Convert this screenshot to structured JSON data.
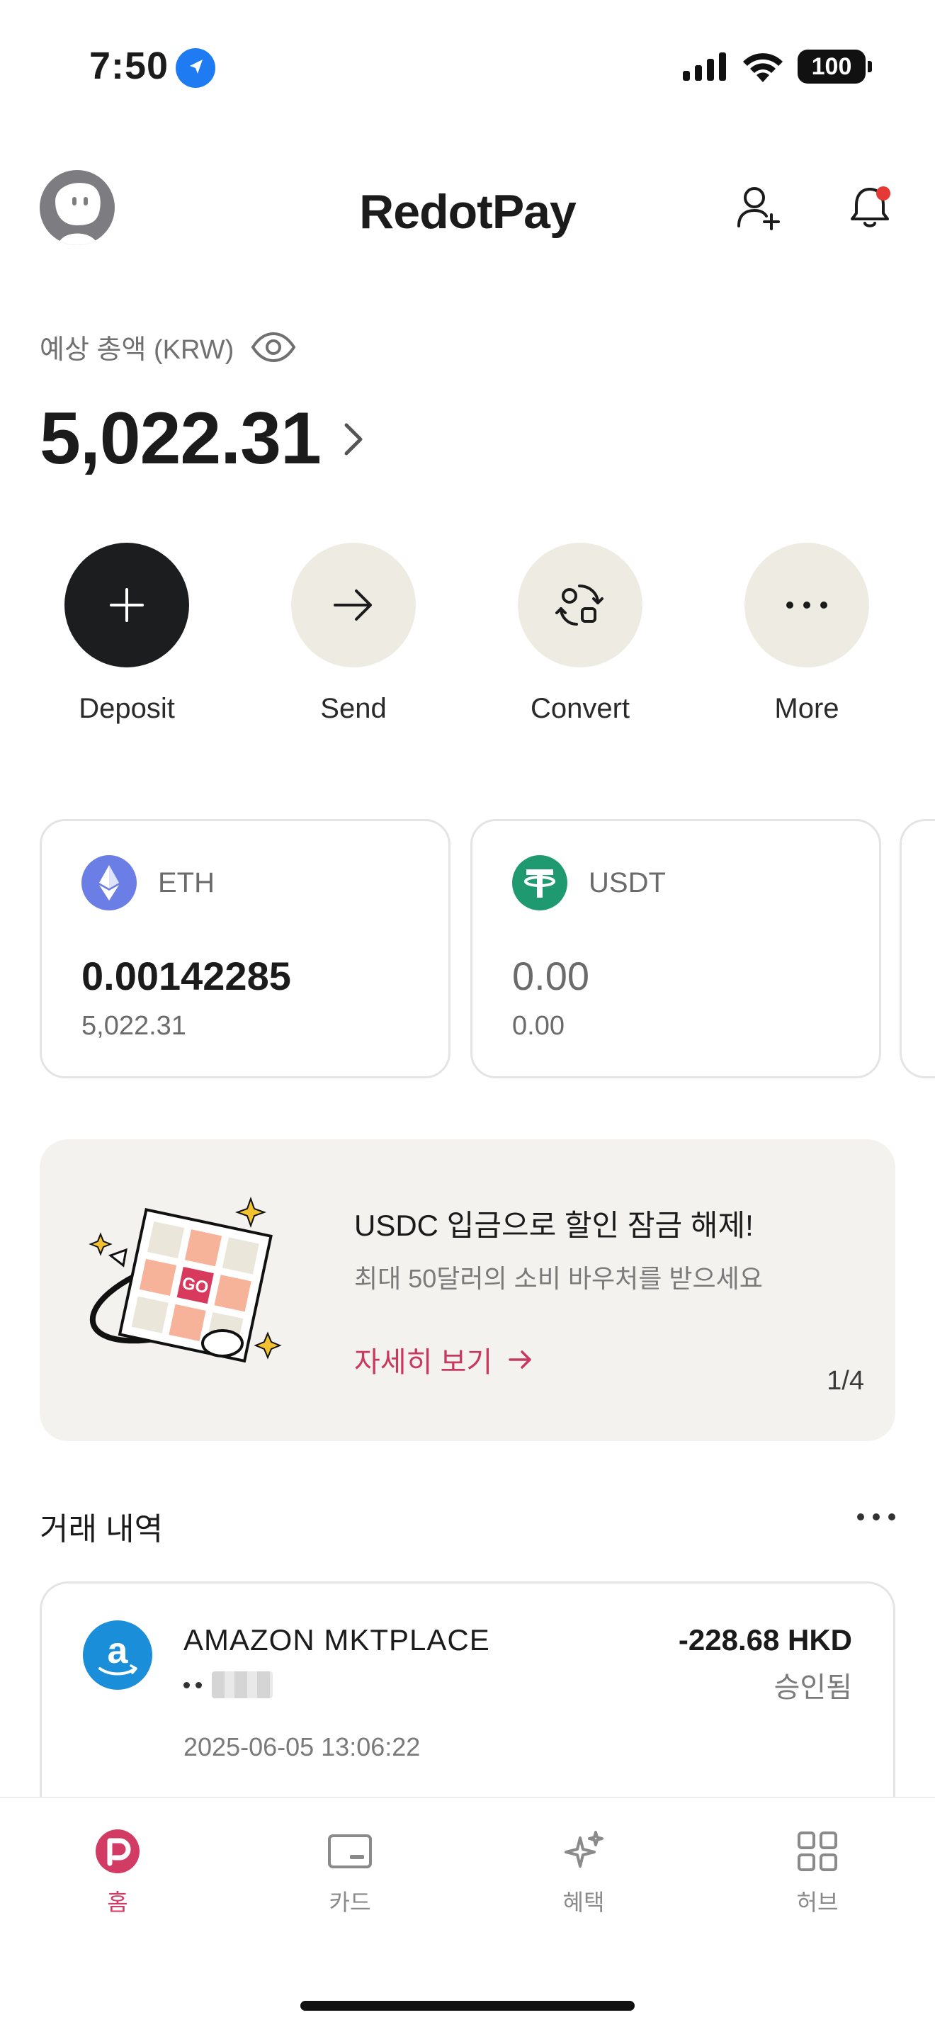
{
  "status_bar": {
    "time": "7:50",
    "battery": "100"
  },
  "header": {
    "brand": "RedotPay",
    "icons": [
      "avatar",
      "add-user-icon",
      "bell-icon"
    ]
  },
  "balance": {
    "label": "예상 총액 (KRW)",
    "value": "5,022.31"
  },
  "actions": [
    {
      "label": "Deposit",
      "icon": "plus-icon"
    },
    {
      "label": "Send",
      "icon": "arrow-right-icon"
    },
    {
      "label": "Convert",
      "icon": "convert-icon"
    },
    {
      "label": "More",
      "icon": "more-icon"
    }
  ],
  "assets": [
    {
      "symbol": "ETH",
      "amount": "0.00142285",
      "fiat": "5,022.31",
      "color": "#6a7ee6"
    },
    {
      "symbol": "USDT",
      "amount": "0.00",
      "fiat": "0.00",
      "color": "#1f9a70"
    }
  ],
  "banner": {
    "title": "USDC 입금으로 할인 잠금 해제!",
    "subtitle": "최대 50달러의 소비 바우처를 받으세요",
    "link": "자세히 보기",
    "page": "1/4",
    "art_label": "GO"
  },
  "transactions": {
    "title": "거래 내역",
    "items": [
      {
        "merchant": "AMAZON MKTPLACE",
        "date": "2025-06-05 13:06:22",
        "amount": "-228.68 HKD",
        "status": "승인됨"
      }
    ]
  },
  "tabs": [
    {
      "label": "홈",
      "icon": "home-icon",
      "active": true
    },
    {
      "label": "카드",
      "icon": "card-icon",
      "active": false
    },
    {
      "label": "혜택",
      "icon": "sparkle-icon",
      "active": false
    },
    {
      "label": "허브",
      "icon": "grid-icon",
      "active": false
    }
  ],
  "colors": {
    "accent": "#d23c64",
    "action_bg": "#eeebe2",
    "dark": "#1b1d1f"
  }
}
